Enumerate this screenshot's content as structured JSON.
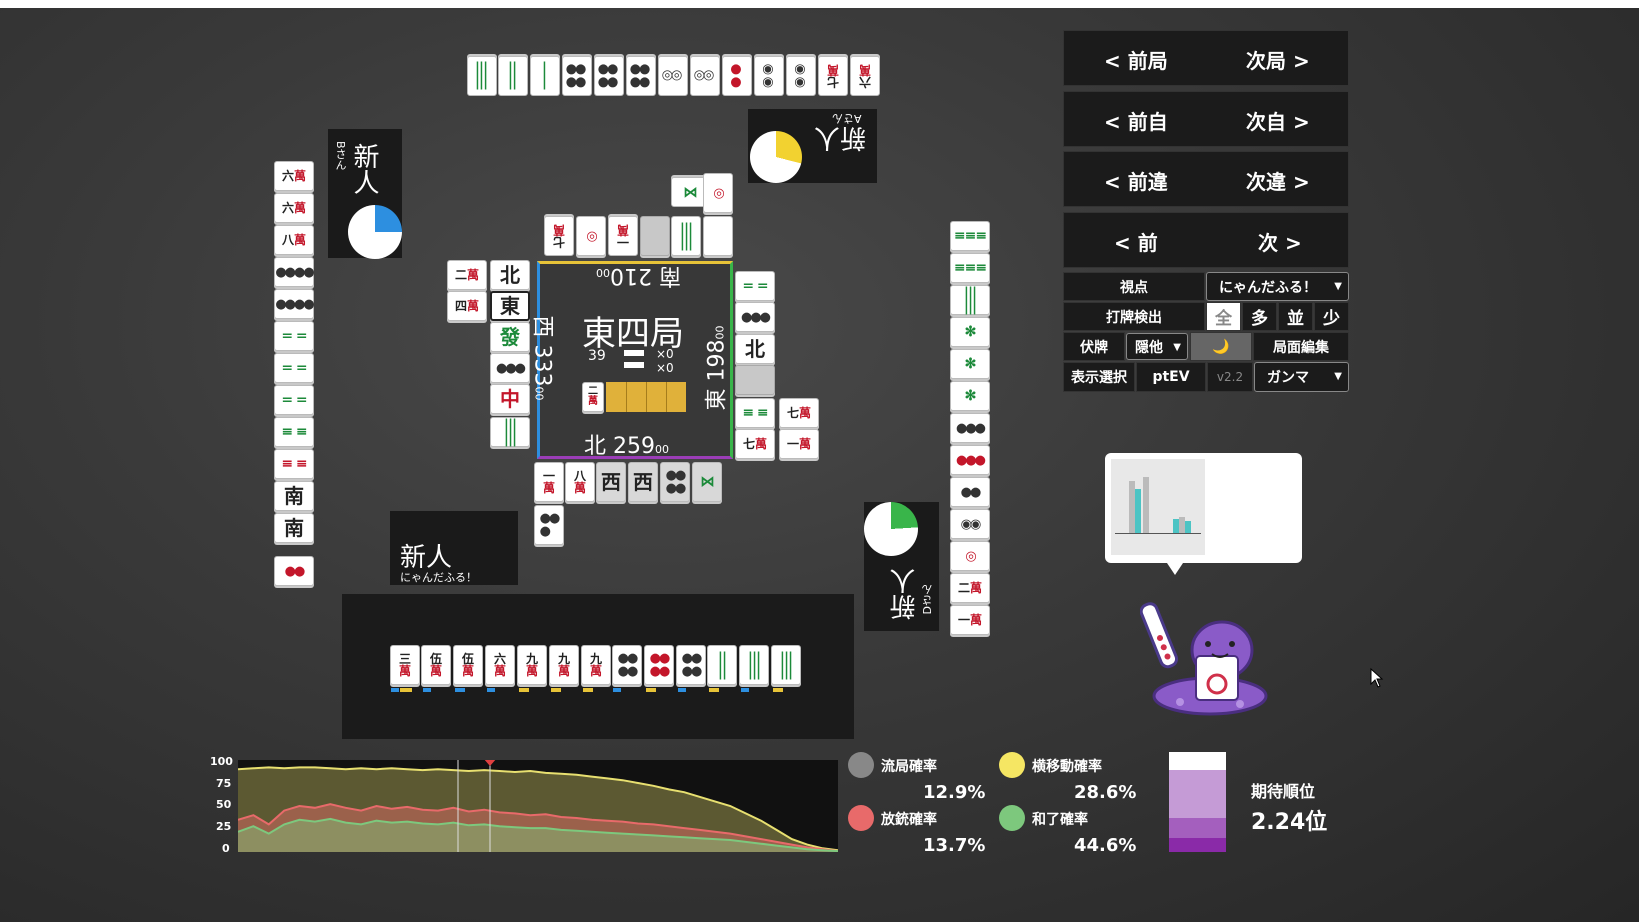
{
  "nav": {
    "prev_round": "< 前局",
    "next_round": "次局 >",
    "prev_self": "< 前自",
    "next_self": "次自 >",
    "prev_diff": "< 前違",
    "next_diff": "次違 >",
    "prev": "< 前",
    "next": "次 >"
  },
  "controls": {
    "viewpoint_label": "視点",
    "viewpoint_value": "にゃんだふる！",
    "discard_detect_label": "打牌検出",
    "detect_options": [
      "全",
      "多",
      "並",
      "少"
    ],
    "hidden_label": "伏牌",
    "hidden_value": "隠他",
    "theme_icon": "🌙",
    "edit_label": "局面編集",
    "display_label": "表示選択",
    "ptev_label": "ptEV",
    "version": "v2.2",
    "mode_value": "ガンマ"
  },
  "board": {
    "round": "東四局",
    "honba": "39",
    "stick1": "×0",
    "stick2": "×0",
    "dora_tile": "二萬",
    "seat_south": "南 210",
    "seat_south_small": "00",
    "seat_west": "西 333",
    "seat_west_small": "00",
    "seat_east": "東 198",
    "seat_east_small": "00",
    "seat_north": "北 259",
    "seat_north_small": "00",
    "colors": {
      "top": "#e7c338",
      "right": "#39b54a",
      "bottom": "#9b3db7",
      "left": "#2d8fe0"
    }
  },
  "players": {
    "self": {
      "rank": "新人",
      "name": "にゃんだふる！"
    },
    "left": {
      "rank": "新人",
      "name": "Bさん"
    },
    "top": {
      "rank": "新人",
      "name": "Aさん"
    },
    "right": {
      "rank": "新人",
      "name": "Dさん"
    }
  },
  "hand": [
    {
      "n": "三",
      "s": "萬"
    },
    {
      "n": "伍",
      "s": "萬"
    },
    {
      "n": "伍",
      "s": "萬"
    },
    {
      "n": "六",
      "s": "萬"
    },
    {
      "n": "九",
      "s": "萬"
    },
    {
      "n": "九",
      "s": "萬"
    },
    {
      "n": "九",
      "s": "萬"
    }
  ],
  "stats": {
    "ryukyoku_label": "流局確率",
    "ryukyoku_value": "12.9%",
    "yoko_label": "横移動確率",
    "yoko_value": "28.6%",
    "houjuu_label": "放銃確率",
    "houjuu_value": "13.7%",
    "agari_label": "和了確率",
    "agari_value": "44.6%",
    "expected_rank_label": "期待順位",
    "expected_rank_value": "2.24位",
    "colors": {
      "ryukyoku": "#888888",
      "yoko": "#f5e663",
      "houjuu": "#e86a6a",
      "agari": "#7dc87d"
    }
  },
  "chart_data": {
    "type": "area",
    "yticks": [
      "100",
      "75",
      "50",
      "25",
      "0"
    ],
    "ylim": [
      0,
      100
    ],
    "series": [
      {
        "color": "#e8e070",
        "values": [
          90,
          91,
          92,
          91,
          92,
          92,
          91,
          90,
          91,
          90,
          91,
          90,
          89,
          90,
          89,
          88,
          89,
          88,
          87,
          88,
          86,
          85,
          84,
          82,
          80,
          78,
          75,
          72,
          68,
          65,
          60,
          55,
          50,
          42,
          34,
          24,
          14,
          8,
          4,
          2
        ]
      },
      {
        "color": "#e86a6a",
        "values": [
          35,
          40,
          30,
          45,
          50,
          48,
          52,
          48,
          45,
          50,
          47,
          49,
          46,
          45,
          48,
          44,
          46,
          43,
          42,
          40,
          41,
          38,
          37,
          35,
          34,
          33,
          31,
          30,
          28,
          26,
          24,
          22,
          20,
          17,
          14,
          11,
          8,
          5,
          3,
          1
        ]
      },
      {
        "color": "#7dc87d",
        "values": [
          22,
          28,
          20,
          30,
          35,
          33,
          36,
          32,
          30,
          34,
          32,
          33,
          31,
          30,
          32,
          29,
          30,
          28,
          27,
          26,
          26,
          24,
          23,
          22,
          21,
          20,
          19,
          18,
          17,
          16,
          15,
          14,
          13,
          11,
          9,
          7,
          5,
          3,
          2,
          1
        ]
      }
    ]
  }
}
